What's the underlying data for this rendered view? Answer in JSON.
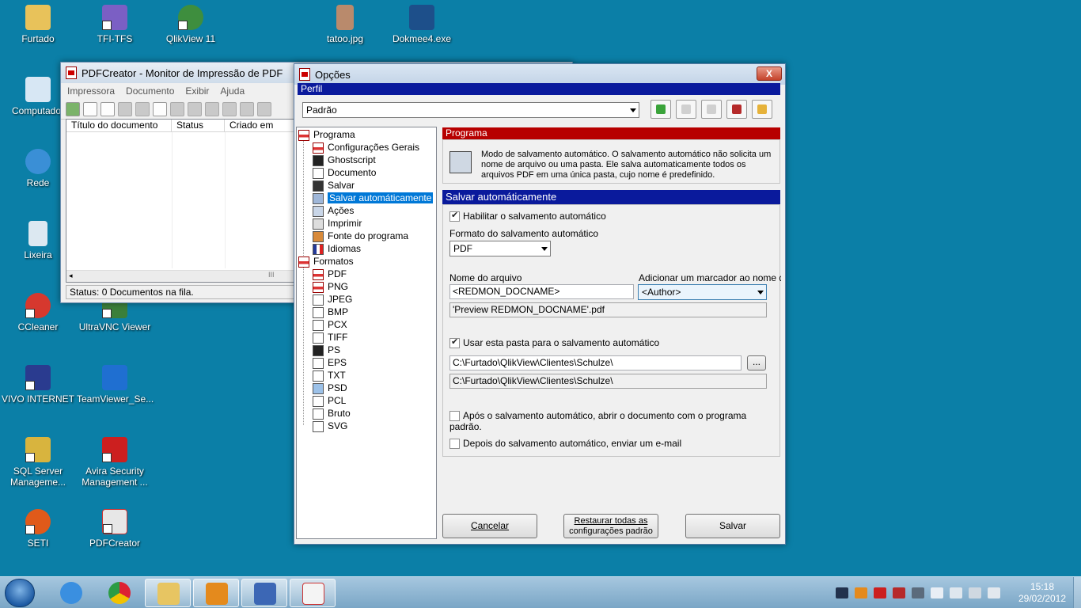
{
  "desktop": {
    "icons": [
      {
        "label": "Furtado",
        "icon": "folder-icon",
        "color": "#e8c25a"
      },
      {
        "label": "TFI-TFS",
        "icon": "tfs-icon",
        "color": "#7b5fc4"
      },
      {
        "label": "QlikView 11",
        "icon": "qlikview-icon",
        "color": "#3e8e3e"
      },
      {
        "label": "tatoo.jpg",
        "icon": "image-file-icon",
        "color": "#b98a6c"
      },
      {
        "label": "Dokmee4.exe",
        "icon": "dokmee-icon",
        "color": "#1d4f8a"
      },
      {
        "label": "Computador",
        "icon": "computer-icon",
        "color": "#d7e7f4"
      },
      {
        "label": "Rede",
        "icon": "network-icon",
        "color": "#3a8fd6"
      },
      {
        "label": "Lixeira",
        "icon": "recycle-bin-icon",
        "color": "#dce8f1"
      },
      {
        "label": "CCleaner",
        "icon": "ccleaner-icon",
        "color": "#d6382e"
      },
      {
        "label": "UltraVNC Viewer",
        "icon": "ultravnc-icon",
        "color": "#3b7f3b"
      },
      {
        "label": "VIVO INTERNET",
        "icon": "vivo-icon",
        "color": "#2a3b8f"
      },
      {
        "label": "TeamViewer_Se...",
        "icon": "teamviewer-icon",
        "color": "#1f6fd1"
      },
      {
        "label": "SQL Server Manageme...",
        "icon": "sql-server-icon",
        "color": "#d8b43e"
      },
      {
        "label": "Avira Security Management ...",
        "icon": "avira-icon",
        "color": "#cc1f1f"
      },
      {
        "label": "SETI",
        "icon": "seti-icon",
        "color": "#e05a1a"
      },
      {
        "label": "PDFCreator",
        "icon": "pdfcreator-icon",
        "color": "#e7e7e7"
      }
    ]
  },
  "pdf_monitor": {
    "title": "PDFCreator - Monitor de Impressão de PDF",
    "menu": [
      "Impressora",
      "Documento",
      "Exibir",
      "Ajuda"
    ],
    "columns": [
      "Título do documento",
      "Status",
      "Criado em"
    ],
    "status": "Status: 0 Documentos na fila.",
    "scroll_grip": "III"
  },
  "options": {
    "title": "Opções",
    "close_label": "X",
    "profile_label": "Perfil",
    "profile_value": "Padrão",
    "tree": {
      "programa": "Programa",
      "programa_children": [
        "Configurações Gerais",
        "Ghostscript",
        "Documento",
        "Salvar",
        "Salvar automáticamente",
        "Ações",
        "Imprimir",
        "Fonte do programa",
        "Idiomas"
      ],
      "formatos": "Formatos",
      "formatos_children": [
        "PDF",
        "PNG",
        "JPEG",
        "BMP",
        "PCX",
        "TIFF",
        "PS",
        "EPS",
        "TXT",
        "PSD",
        "PCL",
        "Bruto",
        "SVG"
      ]
    },
    "panel": {
      "header": "Programa",
      "description": "Modo de salvamento automático. O salvamento automático não solicita um nome de arquivo ou uma pasta. Ele salva automaticamente todos os arquivos PDF em uma única pasta, cujo nome é predefinido.",
      "section_title": "Salvar automáticamente",
      "enable_label": "Habilitar o salvamento automático",
      "format_label": "Formato do salvamento automático",
      "format_value": "PDF",
      "filename_label": "Nome do arquivo",
      "filename_value": "<REDMON_DOCNAME>",
      "marker_label": "Adicionar um marcador ao nome de ar",
      "marker_value": "<Author>",
      "filename_preview": "'Preview REDMON_DOCNAME'.pdf",
      "use_folder_label": "Usar esta pasta para o salvamento automático",
      "folder_value": "C:\\Furtado\\QlikView\\Clientes\\Schulze\\",
      "folder_browse": "...",
      "folder_preview": "C:\\Furtado\\QlikView\\Clientes\\Schulze\\",
      "open_after_label": "Após o salvamento automático, abrir o documento com o programa padrão.",
      "email_after_label": "Depois do salvamento automático, enviar um e-mail"
    },
    "buttons": {
      "cancel": "Cancelar",
      "restore_line1": "Restaurar todas as",
      "restore_line2": "configurações padrão",
      "save": "Salvar"
    }
  },
  "taskbar": {
    "time": "15:18",
    "date": "29/02/2012",
    "apps": [
      {
        "icon": "start-orb-icon"
      },
      {
        "icon": "internet-explorer-icon"
      },
      {
        "icon": "chrome-icon"
      },
      {
        "icon": "explorer-folder-icon"
      },
      {
        "icon": "outlook-icon"
      },
      {
        "icon": "remote-desktop-icon"
      },
      {
        "icon": "pdfcreator-taskbar-icon"
      }
    ]
  }
}
